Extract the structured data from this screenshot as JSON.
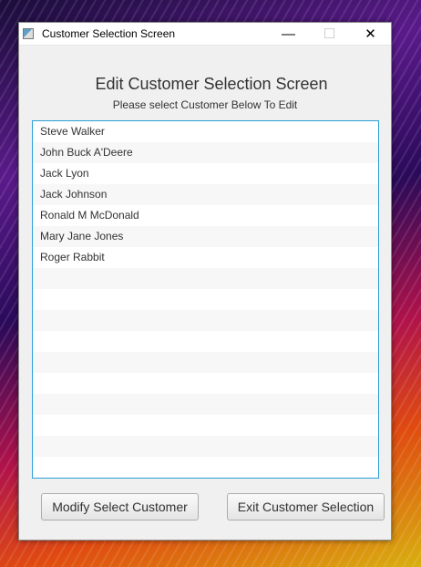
{
  "window": {
    "title": "Customer Selection Screen",
    "controls": {
      "minimize": "—",
      "maximize": "☐",
      "close": "✕"
    }
  },
  "heading": "Edit Customer Selection Screen",
  "subheading": "Please select Customer Below To Edit",
  "customers": [
    "Steve Walker",
    "John Buck A'Deere",
    "Jack Lyon",
    "Jack Johnson",
    "Ronald M McDonald",
    "Mary Jane Jones",
    "Roger Rabbit",
    "",
    "",
    "",
    "",
    "",
    "",
    "",
    "",
    "",
    ""
  ],
  "buttons": {
    "modify": "Modify Select Customer",
    "exit": "Exit Customer Selection"
  }
}
